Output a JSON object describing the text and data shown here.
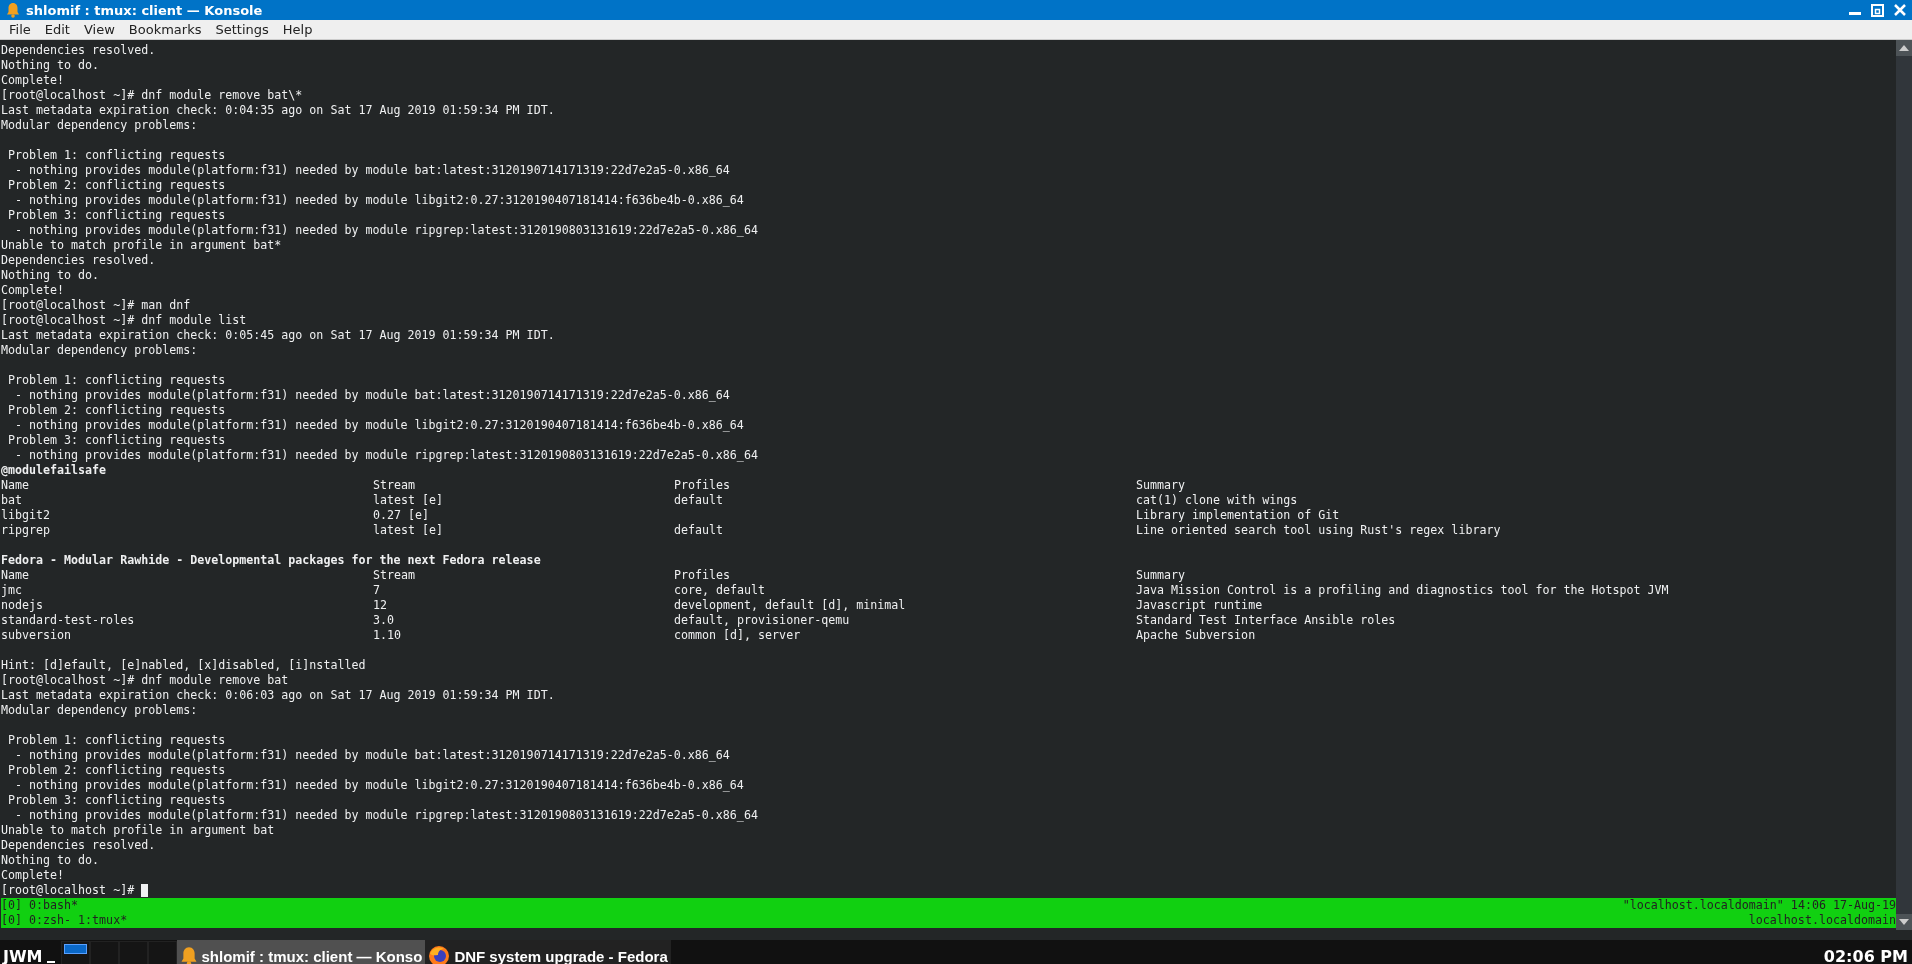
{
  "window": {
    "title": "shlomif : tmux: client — Konsole"
  },
  "menu": [
    "File",
    "Edit",
    "View",
    "Bookmarks",
    "Settings",
    "Help"
  ],
  "terminal": {
    "lines": [
      {
        "kind": "text",
        "text": "Dependencies resolved."
      },
      {
        "kind": "text",
        "text": "Nothing to do."
      },
      {
        "kind": "text",
        "text": "Complete!"
      },
      {
        "kind": "text",
        "text": "[root@localhost ~]# dnf module remove bat\\*"
      },
      {
        "kind": "text",
        "text": "Last metadata expiration check: 0:04:35 ago on Sat 17 Aug 2019 01:59:34 PM IDT."
      },
      {
        "kind": "text",
        "text": "Modular dependency problems:"
      },
      {
        "kind": "blank"
      },
      {
        "kind": "text",
        "text": " Problem 1: conflicting requests"
      },
      {
        "kind": "text",
        "text": "  - nothing provides module(platform:f31) needed by module bat:latest:3120190714171319:22d7e2a5-0.x86_64"
      },
      {
        "kind": "text",
        "text": " Problem 2: conflicting requests"
      },
      {
        "kind": "text",
        "text": "  - nothing provides module(platform:f31) needed by module libgit2:0.27:3120190407181414:f636be4b-0.x86_64"
      },
      {
        "kind": "text",
        "text": " Problem 3: conflicting requests"
      },
      {
        "kind": "text",
        "text": "  - nothing provides module(platform:f31) needed by module ripgrep:latest:3120190803131619:22d7e2a5-0.x86_64"
      },
      {
        "kind": "text",
        "text": "Unable to match profile in argument bat*"
      },
      {
        "kind": "text",
        "text": "Dependencies resolved."
      },
      {
        "kind": "text",
        "text": "Nothing to do."
      },
      {
        "kind": "text",
        "text": "Complete!"
      },
      {
        "kind": "text",
        "text": "[root@localhost ~]# man dnf"
      },
      {
        "kind": "text",
        "text": "[root@localhost ~]# dnf module list"
      },
      {
        "kind": "text",
        "text": "Last metadata expiration check: 0:05:45 ago on Sat 17 Aug 2019 01:59:34 PM IDT."
      },
      {
        "kind": "text",
        "text": "Modular dependency problems:"
      },
      {
        "kind": "blank"
      },
      {
        "kind": "text",
        "text": " Problem 1: conflicting requests"
      },
      {
        "kind": "text",
        "text": "  - nothing provides module(platform:f31) needed by module bat:latest:3120190714171319:22d7e2a5-0.x86_64"
      },
      {
        "kind": "text",
        "text": " Problem 2: conflicting requests"
      },
      {
        "kind": "text",
        "text": "  - nothing provides module(platform:f31) needed by module libgit2:0.27:3120190407181414:f636be4b-0.x86_64"
      },
      {
        "kind": "text",
        "text": " Problem 3: conflicting requests"
      },
      {
        "kind": "text",
        "text": "  - nothing provides module(platform:f31) needed by module ripgrep:latest:3120190803131619:22d7e2a5-0.x86_64"
      },
      {
        "kind": "heading",
        "text": "@modulefailsafe"
      },
      {
        "kind": "row",
        "cells": [
          "Name",
          "Stream",
          "Profiles",
          "Summary"
        ]
      },
      {
        "kind": "row",
        "cells": [
          "bat",
          "latest [e]",
          "default",
          "cat(1) clone with wings"
        ]
      },
      {
        "kind": "row",
        "cells": [
          "libgit2",
          "0.27 [e]",
          null,
          "Library implementation of Git"
        ]
      },
      {
        "kind": "row",
        "cells": [
          "ripgrep",
          "latest [e]",
          "default",
          "Line oriented search tool using Rust's regex library"
        ]
      },
      {
        "kind": "blank"
      },
      {
        "kind": "heading",
        "text": "Fedora - Modular Rawhide - Developmental packages for the next Fedora release"
      },
      {
        "kind": "row",
        "cells": [
          "Name",
          "Stream",
          "Profiles",
          "Summary"
        ]
      },
      {
        "kind": "row",
        "cells": [
          "jmc",
          "7",
          "core, default",
          "Java Mission Control is a profiling and diagnostics tool for the Hotspot JVM"
        ]
      },
      {
        "kind": "row",
        "cells": [
          "nodejs",
          "12",
          "development, default [d], minimal",
          "Javascript runtime"
        ]
      },
      {
        "kind": "row",
        "cells": [
          "standard-test-roles",
          "3.0",
          "default, provisioner-qemu",
          "Standard Test Interface Ansible roles"
        ]
      },
      {
        "kind": "row",
        "cells": [
          "subversion",
          "1.10",
          "common [d], server",
          "Apache Subversion"
        ]
      },
      {
        "kind": "blank"
      },
      {
        "kind": "text",
        "text": "Hint: [d]efault, [e]nabled, [x]disabled, [i]nstalled"
      },
      {
        "kind": "text",
        "text": "[root@localhost ~]# dnf module remove bat"
      },
      {
        "kind": "text",
        "text": "Last metadata expiration check: 0:06:03 ago on Sat 17 Aug 2019 01:59:34 PM IDT."
      },
      {
        "kind": "text",
        "text": "Modular dependency problems:"
      },
      {
        "kind": "blank"
      },
      {
        "kind": "text",
        "text": " Problem 1: conflicting requests"
      },
      {
        "kind": "text",
        "text": "  - nothing provides module(platform:f31) needed by module bat:latest:3120190714171319:22d7e2a5-0.x86_64"
      },
      {
        "kind": "text",
        "text": " Problem 2: conflicting requests"
      },
      {
        "kind": "text",
        "text": "  - nothing provides module(platform:f31) needed by module libgit2:0.27:3120190407181414:f636be4b-0.x86_64"
      },
      {
        "kind": "text",
        "text": " Problem 3: conflicting requests"
      },
      {
        "kind": "text",
        "text": "  - nothing provides module(platform:f31) needed by module ripgrep:latest:3120190803131619:22d7e2a5-0.x86_64"
      },
      {
        "kind": "text",
        "text": "Unable to match profile in argument bat"
      },
      {
        "kind": "text",
        "text": "Dependencies resolved."
      },
      {
        "kind": "text",
        "text": "Nothing to do."
      },
      {
        "kind": "text",
        "text": "Complete!"
      },
      {
        "kind": "text",
        "text": "[root@localhost ~]#",
        "cursor": true
      }
    ]
  },
  "tmux_status": {
    "left": [
      "[0] 0:bash*",
      "[0] 0:zsh- 1:tmux*"
    ],
    "right": [
      "\"localhost.localdomain\" 14:06 17-Aug-19",
      "localhost.localdomain"
    ]
  },
  "taskbar": {
    "menu_label": "JWM",
    "desktops": [
      {
        "selected": true
      },
      {
        "selected": false
      },
      {
        "selected": false
      },
      {
        "selected": false
      }
    ],
    "tasks": [
      {
        "kind": "konsole",
        "label": "shlomif : tmux: client — Konso",
        "selected": true
      },
      {
        "kind": "browser",
        "label": "DNF system upgrade - Fedora",
        "selected": false
      }
    ],
    "clock": "02:06 PM"
  }
}
